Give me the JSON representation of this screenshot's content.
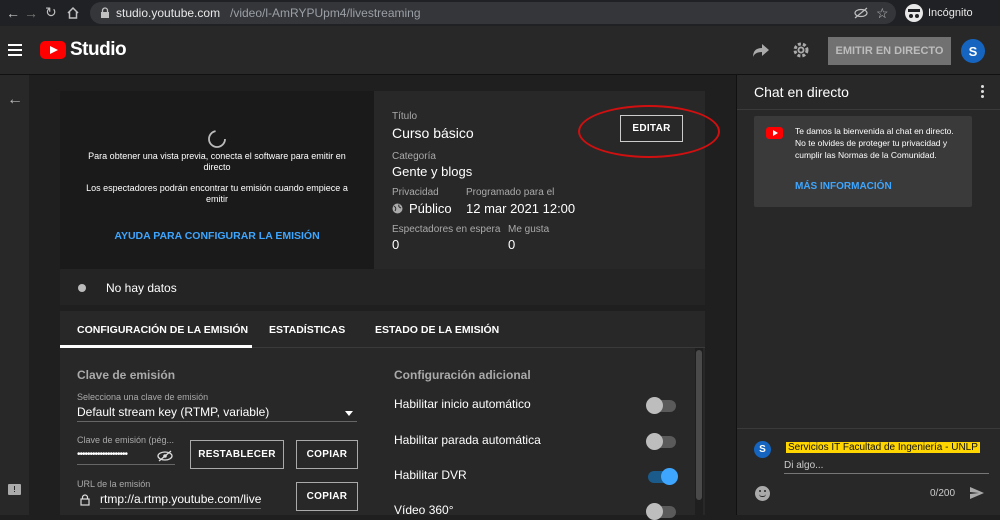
{
  "browser": {
    "url_domain": "studio.youtube.com",
    "url_path": "/video/l-AmRYPUpm4/livestreaming",
    "incognito_label": "Incógnito",
    "icons": [
      "back-arrow-icon",
      "forward-arrow-icon",
      "reload-icon",
      "home-icon",
      "lock-icon",
      "eye-off-icon",
      "star-icon",
      "incognito-icon"
    ]
  },
  "header": {
    "logo_text": "Studio",
    "go_live_label": "EMITIR EN DIRECTO",
    "avatar_letter": "S",
    "brand_red": "#ff0000",
    "accent_blue": "#3ea6ff"
  },
  "preview": {
    "line1": "Para obtener una vista previa, conecta el software para emitir en directo",
    "line2": "Los espectadores podrán encontrar tu emisión cuando empiece a emitir",
    "help_link": "AYUDA PARA CONFIGURAR LA EMISIÓN"
  },
  "details": {
    "title_label": "Título",
    "title_value": "Curso básico",
    "edit_label": "EDITAR",
    "category_label": "Categoría",
    "category_value": "Gente y blogs",
    "privacy_label": "Privacidad",
    "privacy_value": "Público",
    "scheduled_label": "Programado para el",
    "scheduled_value": "12 mar 2021 12:00",
    "waiting_label": "Espectadores en espera",
    "waiting_value": "0",
    "likes_label": "Me gusta",
    "likes_value": "0"
  },
  "status": {
    "text": "No hay datos"
  },
  "tabs": [
    {
      "label": "CONFIGURACIÓN DE LA EMISIÓN",
      "active": true
    },
    {
      "label": "ESTADÍSTICAS",
      "active": false
    },
    {
      "label": "ESTADO DE LA EMISIÓN",
      "active": false
    }
  ],
  "stream_key": {
    "section_title": "Clave de emisión",
    "select_label": "Selecciona una clave de emisión",
    "select_value": "Default stream key (RTMP, variable)",
    "key_label": "Clave de emisión (pég...",
    "key_value": "••••••••••••••••••••",
    "reset_label": "RESTABLECER",
    "copy_label": "COPIAR",
    "url_label": "URL de la emisión",
    "url_value": "rtmp://a.rtmp.youtube.com/live",
    "copy_url_label": "COPIAR"
  },
  "additional": {
    "section_title": "Configuración adicional",
    "options": [
      {
        "label": "Habilitar inicio automático",
        "on": false
      },
      {
        "label": "Habilitar parada automática",
        "on": false
      },
      {
        "label": "Habilitar DVR",
        "on": true
      },
      {
        "label": "Vídeo 360°",
        "on": false
      }
    ]
  },
  "chat": {
    "title": "Chat en directo",
    "welcome": "Te damos la bienvenida al chat en directo. No te olvides de proteger tu privacidad y cumplir las Normas de la Comunidad.",
    "more_info": "MÁS INFORMACIÓN",
    "author": "Servicios IT Facultad de Ingeniería - UNLP",
    "author_highlight": "#ffd600",
    "avatar_letter": "S",
    "input_placeholder": "Di algo...",
    "counter": "0/200"
  }
}
